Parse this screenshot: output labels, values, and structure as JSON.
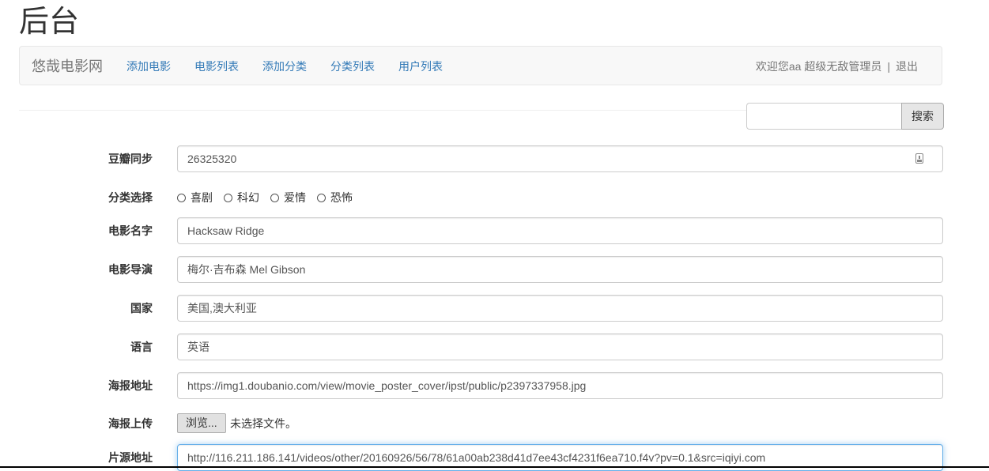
{
  "page": {
    "title": "后台"
  },
  "navbar": {
    "brand": "悠哉电影网",
    "links": [
      "添加电影",
      "电影列表",
      "添加分类",
      "分类列表",
      "用户列表"
    ],
    "welcome": "欢迎您aa 超级无敌管理员",
    "separator": "|",
    "logout": "退出"
  },
  "search": {
    "value": "",
    "button_label": "搜索"
  },
  "form": {
    "douban": {
      "label": "豆瓣同步",
      "value": "26325320",
      "icon": "contact-card-icon"
    },
    "category": {
      "label": "分类选择",
      "options": [
        "喜剧",
        "科幻",
        "爱情",
        "恐怖"
      ],
      "selected": null
    },
    "name": {
      "label": "电影名字",
      "value": "Hacksaw Ridge"
    },
    "director": {
      "label": "电影导演",
      "value": "梅尔·吉布森 Mel Gibson"
    },
    "country": {
      "label": "国家",
      "value": "美国,澳大利亚"
    },
    "language": {
      "label": "语言",
      "value": "英语"
    },
    "poster_url": {
      "label": "海报地址",
      "value": "https://img1.doubanio.com/view/movie_poster_cover/ipst/public/p2397337958.jpg"
    },
    "poster_upload": {
      "label": "海报上传",
      "button_label": "浏览...",
      "status": "未选择文件。"
    },
    "source_url": {
      "label": "片源地址",
      "value": "http://116.211.186.141/videos/other/20160926/56/78/61a00ab238d41d7ee43cf4231f6ea710.f4v?pv=0.1&src=iqiyi.com"
    }
  },
  "colors": {
    "link": "#337ab7",
    "navbar_bg": "#f8f8f8",
    "focus_border": "#66afe9"
  }
}
